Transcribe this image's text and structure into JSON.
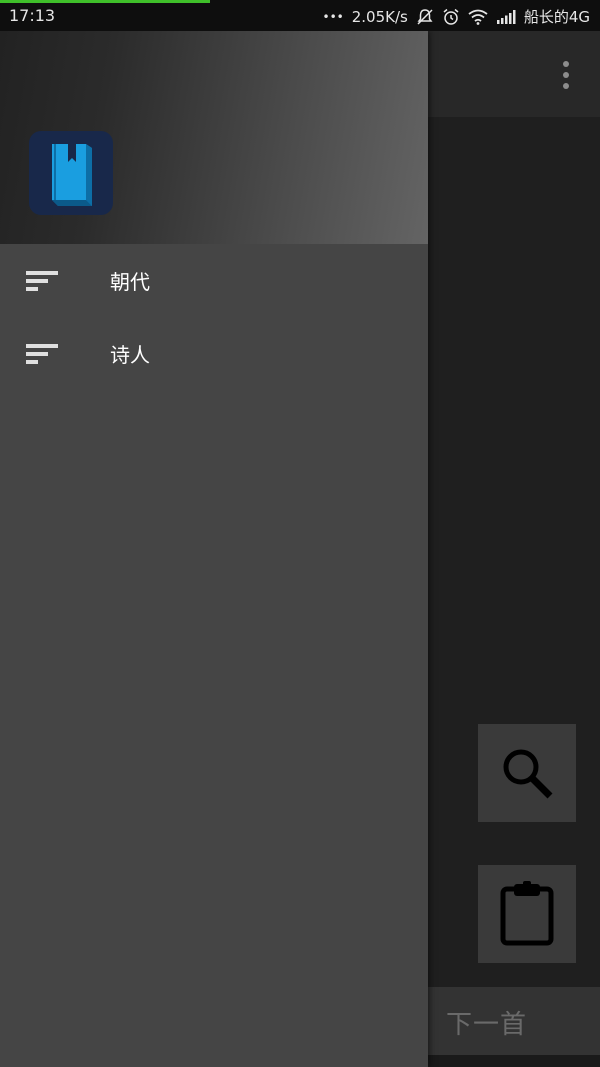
{
  "status_bar": {
    "time": "17:13",
    "dots": "•••",
    "speed": "2.05K/s",
    "carrier": "船长的4G",
    "progress_color": "#3fbf2a"
  },
  "drawer": {
    "logo_icon": "book-icon",
    "items": [
      {
        "label": "朝代",
        "icon": "sort-lines-icon"
      },
      {
        "label": "诗人",
        "icon": "sort-lines-icon"
      }
    ]
  },
  "main": {
    "search_icon": "search-icon",
    "clipboard_icon": "clipboard-icon",
    "next_label": "下一首"
  },
  "colors": {
    "drawer_bg": "#454545",
    "logo_blue": "#1a9ee0",
    "logo_bg": "#18284a"
  }
}
